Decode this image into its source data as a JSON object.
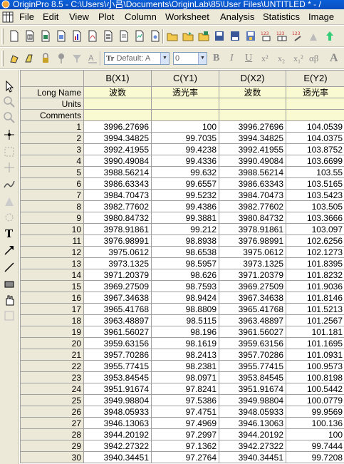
{
  "window": {
    "title": "OriginPro 8.5 - C:\\Users\\小吕\\Documents\\OriginLab\\85\\User Files\\UNTITLED * - /"
  },
  "menu": [
    "File",
    "Edit",
    "View",
    "Plot",
    "Column",
    "Worksheet",
    "Analysis",
    "Statistics",
    "Image"
  ],
  "format_toolbar": {
    "font_value": "Default: A",
    "size_value": "0",
    "bold": "B",
    "italic": "I",
    "underline": "U",
    "superscript": "x²",
    "subscript": "x₂",
    "supersub": "x₁²",
    "greek": "αβ",
    "big_a": "A"
  },
  "columns": [
    "B(X1)",
    "C(Y1)",
    "D(X2)",
    "E(Y2)"
  ],
  "meta_rows": [
    {
      "label": "Long Name",
      "cells": [
        "波数",
        "透光率",
        "波数",
        "透光率"
      ]
    },
    {
      "label": "Units",
      "cells": [
        "",
        "",
        "",
        ""
      ]
    },
    {
      "label": "Comments",
      "cells": [
        "",
        "",
        "",
        ""
      ]
    }
  ],
  "rows": [
    [
      "1",
      "3996.27696",
      "100",
      "3996.27696",
      "104.0539"
    ],
    [
      "2",
      "3994.34825",
      "99.7035",
      "3994.34825",
      "104.0375"
    ],
    [
      "3",
      "3992.41955",
      "99.4238",
      "3992.41955",
      "103.8752"
    ],
    [
      "4",
      "3990.49084",
      "99.4336",
      "3990.49084",
      "103.6699"
    ],
    [
      "5",
      "3988.56214",
      "99.632",
      "3988.56214",
      "103.55"
    ],
    [
      "6",
      "3986.63343",
      "99.6557",
      "3986.63343",
      "103.5165"
    ],
    [
      "7",
      "3984.70473",
      "99.5232",
      "3984.70473",
      "103.5423"
    ],
    [
      "8",
      "3982.77602",
      "99.4386",
      "3982.77602",
      "103.505"
    ],
    [
      "9",
      "3980.84732",
      "99.3881",
      "3980.84732",
      "103.3666"
    ],
    [
      "10",
      "3978.91861",
      "99.212",
      "3978.91861",
      "103.097"
    ],
    [
      "11",
      "3976.98991",
      "98.8938",
      "3976.98991",
      "102.6256"
    ],
    [
      "12",
      "3975.0612",
      "98.6538",
      "3975.0612",
      "102.1273"
    ],
    [
      "13",
      "3973.1325",
      "98.5957",
      "3973.1325",
      "101.8395"
    ],
    [
      "14",
      "3971.20379",
      "98.626",
      "3971.20379",
      "101.8232"
    ],
    [
      "15",
      "3969.27509",
      "98.7593",
      "3969.27509",
      "101.9036"
    ],
    [
      "16",
      "3967.34638",
      "98.9424",
      "3967.34638",
      "101.8146"
    ],
    [
      "17",
      "3965.41768",
      "98.8809",
      "3965.41768",
      "101.5213"
    ],
    [
      "18",
      "3963.48897",
      "98.5115",
      "3963.48897",
      "101.2567"
    ],
    [
      "19",
      "3961.56027",
      "98.196",
      "3961.56027",
      "101.181"
    ],
    [
      "20",
      "3959.63156",
      "98.1619",
      "3959.63156",
      "101.1695"
    ],
    [
      "21",
      "3957.70286",
      "98.2413",
      "3957.70286",
      "101.0931"
    ],
    [
      "22",
      "3955.77415",
      "98.2381",
      "3955.77415",
      "100.9573"
    ],
    [
      "23",
      "3953.84545",
      "98.0971",
      "3953.84545",
      "100.8198"
    ],
    [
      "24",
      "3951.91674",
      "97.8241",
      "3951.91674",
      "100.5442"
    ],
    [
      "25",
      "3949.98804",
      "97.5386",
      "3949.98804",
      "100.0779"
    ],
    [
      "26",
      "3948.05933",
      "97.4751",
      "3948.05933",
      "99.9569"
    ],
    [
      "27",
      "3946.13063",
      "97.4969",
      "3946.13063",
      "100.136"
    ],
    [
      "28",
      "3944.20192",
      "97.2997",
      "3944.20192",
      "100"
    ],
    [
      "29",
      "3942.27322",
      "97.1362",
      "3942.27322",
      "99.7444"
    ],
    [
      "30",
      "3940.34451",
      "97.2764",
      "3940.34451",
      "99.7208"
    ]
  ]
}
